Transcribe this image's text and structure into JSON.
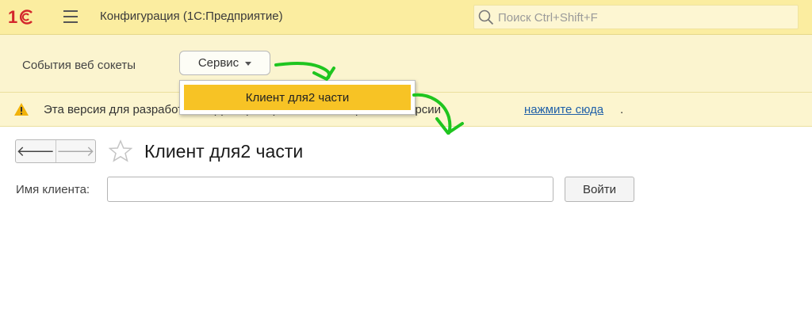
{
  "header": {
    "app_title": "Конфигурация  (1С:Предприятие)",
    "search_placeholder": "Поиск Ctrl+Shift+F",
    "logo": "1c-logo",
    "menu_icon": "hamburger-menu-icon",
    "search_icon": "search-icon"
  },
  "section": {
    "link_label": "События веб сокеты",
    "service_button_label": "Сервис"
  },
  "dropdown": {
    "items": [
      {
        "label": "Клиент для2 части",
        "selected": true
      }
    ]
  },
  "warning": {
    "icon": "warning-triangle-icon",
    "text": "Эта версия для разработчика. Для приобретения коммерческой версии",
    "link": "нажмите сюда",
    "suffix": "."
  },
  "form": {
    "title": "Клиент для2 части",
    "back_label": "🡐",
    "forward_label": "🡒",
    "favorite_icon": "star-icon",
    "client_name_label": "Имя клиента:",
    "client_name_value": "",
    "login_button_label": "Войти"
  },
  "colors": {
    "header_bg": "#fbeda0",
    "panel_bg": "#fbf4cf",
    "highlight": "#f7c325",
    "link": "#1f5fa8",
    "annotation": "#1fc51f"
  }
}
